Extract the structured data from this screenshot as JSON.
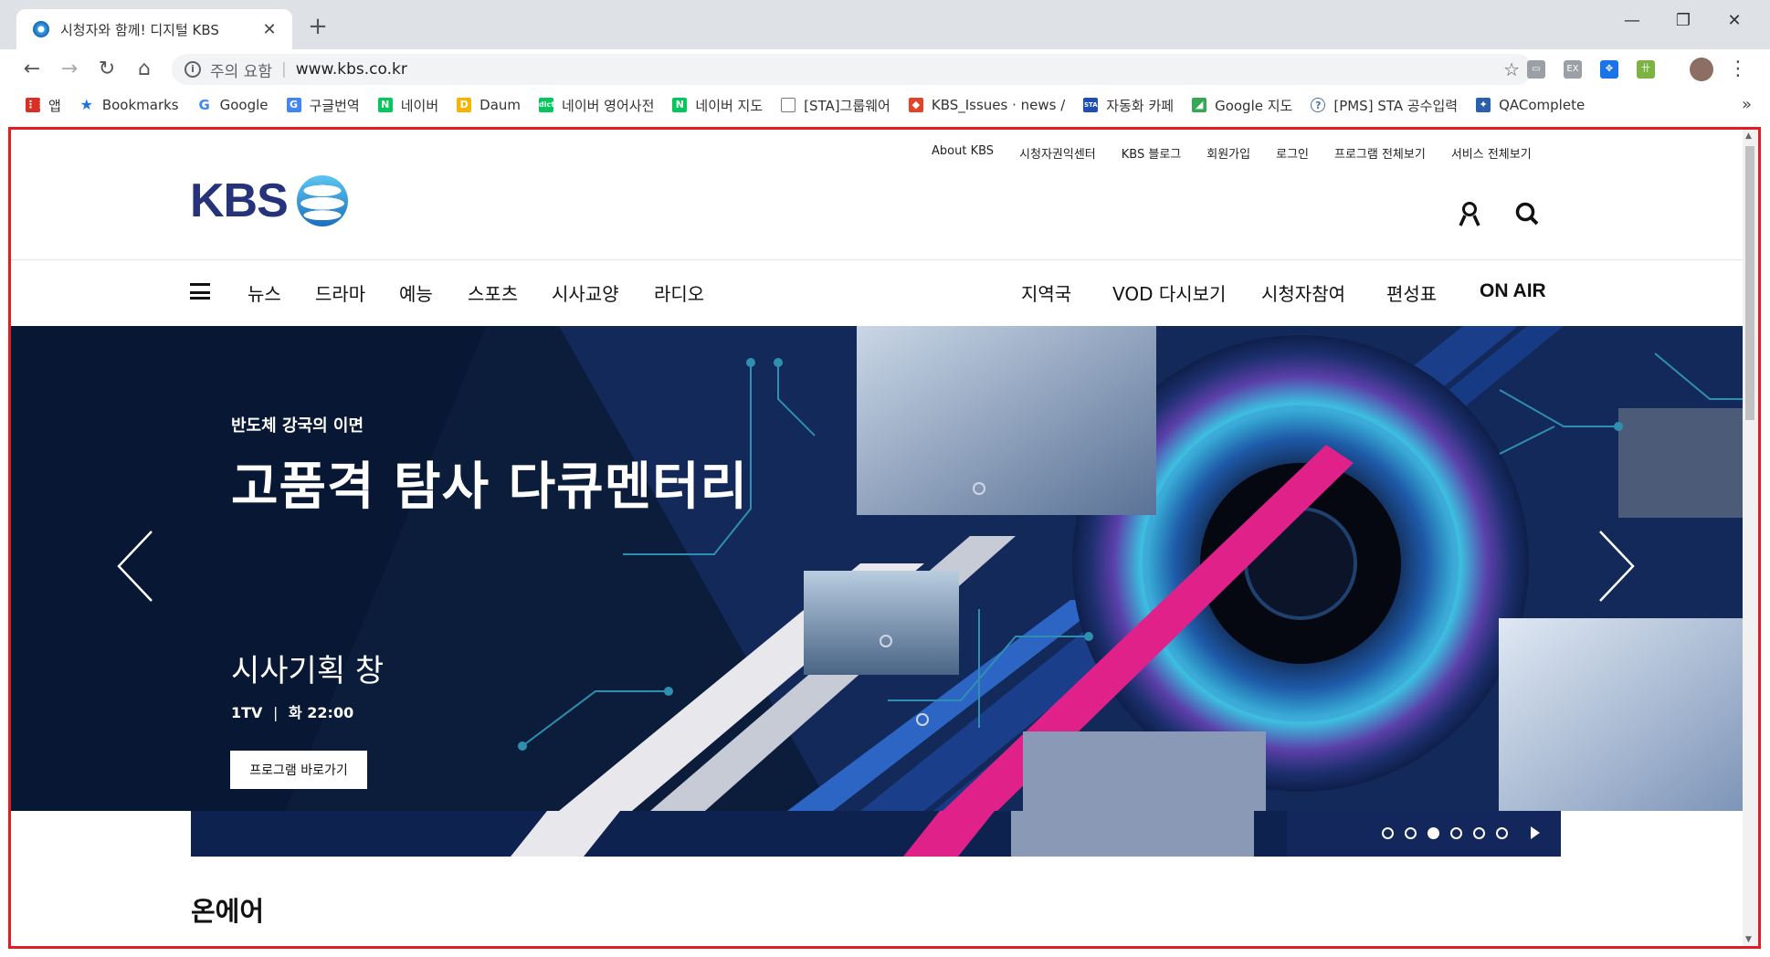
{
  "browser": {
    "tab_title": "시청자와 함께! 디지털 KBS",
    "security_text": "주의 요함",
    "url": "www.kbs.co.kr",
    "bookmarks": [
      {
        "label": "앱",
        "icon": "apps-grid-icon",
        "color": "#d93025"
      },
      {
        "label": "Bookmarks",
        "icon": "star-icon",
        "color": "#1a73e8"
      },
      {
        "label": "Google",
        "icon": "google-icon",
        "color": "#4285f4"
      },
      {
        "label": "구글번역",
        "icon": "translate-icon",
        "color": "#4285f4"
      },
      {
        "label": "네이버",
        "icon": "naver-icon",
        "color": "#03c75a"
      },
      {
        "label": "Daum",
        "icon": "daum-icon",
        "color": "#f4b400"
      },
      {
        "label": "네이버 영어사전",
        "icon": "naver-dict-icon",
        "color": "#03c75a"
      },
      {
        "label": "네이버 지도",
        "icon": "naver-icon",
        "color": "#03c75a"
      },
      {
        "label": "[STA]그룹웨어",
        "icon": "page-icon",
        "color": "#888888"
      },
      {
        "label": "KBS_Issues · news / ",
        "icon": "gitlab-icon",
        "color": "#e24329"
      },
      {
        "label": "자동화 카페",
        "icon": "cafe-icon",
        "color": "#1e4fb2"
      },
      {
        "label": "Google 지도",
        "icon": "maps-icon",
        "color": "#34a853"
      },
      {
        "label": "[PMS] STA 공수입력",
        "icon": "pms-icon",
        "color": "#4a6fa5"
      },
      {
        "label": "QAComplete",
        "icon": "qacomplete-icon",
        "color": "#2b5fab"
      }
    ]
  },
  "kbs": {
    "util_links": [
      "About KBS",
      "시청자권익센터",
      "KBS 블로그",
      "회원가입",
      "로그인",
      "프로그램 전체보기",
      "서비스 전체보기"
    ],
    "logo_text": "KBS",
    "nav_left": [
      "뉴스",
      "드라마",
      "예능",
      "스포츠",
      "시사교양",
      "라디오"
    ],
    "nav_right": [
      "지역국",
      "VOD 다시보기",
      "시청자참여",
      "편성표"
    ],
    "onair": "ON AIR",
    "banner": {
      "subtitle": "반도체 강국의 이면",
      "title": "고품격 탐사 다큐멘터리",
      "program": "시사기획 창",
      "channel": "1TV",
      "time": "화 22:00",
      "button": "프로그램 바로가기",
      "slide_count": 6,
      "active_slide": 3
    },
    "section_title": "온에어"
  },
  "colors": {
    "frame": "#e31b23",
    "logo": "#26337a",
    "banner_bg": "#0b1d3b",
    "accent_stripe": "#e0218a"
  }
}
